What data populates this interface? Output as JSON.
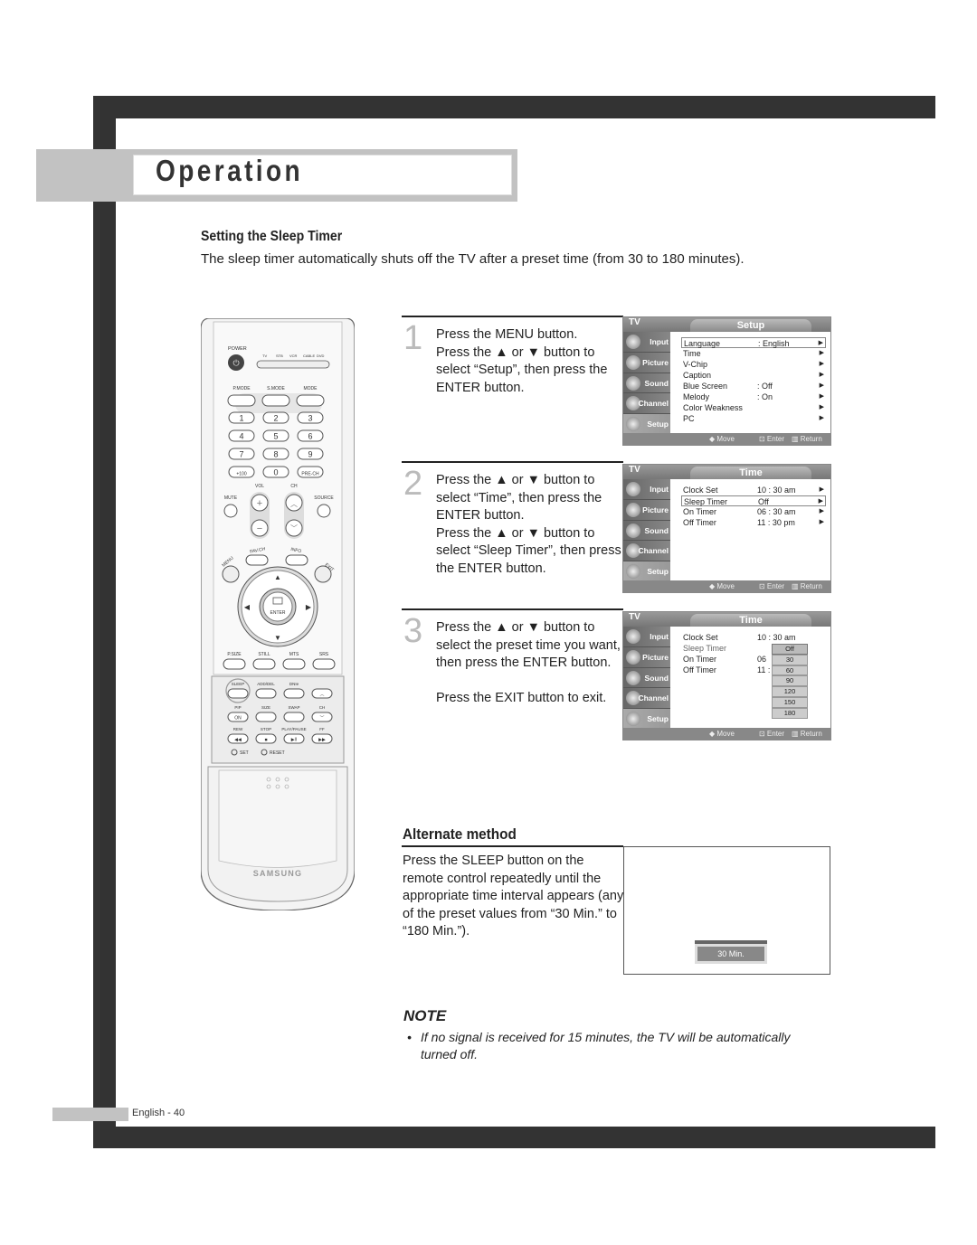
{
  "section_title": "Operation",
  "heading": "Setting the Sleep Timer",
  "intro": "The sleep timer automatically shuts off the TV after a preset time (from 30 to 180 minutes).",
  "remote": {
    "brand": "SAMSUNG",
    "labels": {
      "power": "POWER",
      "sources": [
        "TV",
        "STB",
        "VCR",
        "CABLE",
        "DVD"
      ],
      "modes": [
        "P.MODE",
        "S.MODE",
        "MODE"
      ],
      "digits": [
        "1",
        "2",
        "3",
        "4",
        "5",
        "6",
        "7",
        "8",
        "9",
        "+100",
        "0",
        "PRE-CH"
      ],
      "vol": "VOL",
      "ch": "CH",
      "mute": "MUTE",
      "source": "SOURCE",
      "fav_ch": "FAV.CH",
      "info": "INFO",
      "menu": "MENU",
      "exit": "EXIT",
      "enter": "ENTER",
      "row_fn": [
        "P.SIZE",
        "STILL",
        "MTS",
        "SRS"
      ],
      "row_a": [
        "SLEEP",
        "ADD/DEL",
        "DNIe",
        ""
      ],
      "row_b": [
        "PIP",
        "SIZE",
        "SWAP",
        "CH"
      ],
      "pip_on": "ON",
      "row_c": [
        "REW",
        "STOP",
        "PLAY/PAUSE",
        "FF"
      ],
      "set": "SET",
      "reset": "RESET"
    }
  },
  "steps": [
    {
      "num": "1",
      "lines": [
        "Press the MENU button.",
        "Press the ▲ or ▼ button to select “Setup”, then press the ENTER button."
      ]
    },
    {
      "num": "2",
      "lines": [
        "Press the ▲ or ▼ button to select “Time”, then press the ENTER button.",
        "Press the ▲ or ▼ button to select “Sleep Timer”, then press the ENTER button."
      ]
    },
    {
      "num": "3",
      "lines": [
        "Press the ▲ or ▼ button to select the preset time you want, then press the ENTER button.",
        "",
        "Press the EXIT button to exit."
      ]
    }
  ],
  "osd": {
    "tv_label": "TV",
    "sidebar": [
      "Input",
      "Picture",
      "Sound",
      "Channel",
      "Setup"
    ],
    "footer": {
      "move": "◆ Move",
      "enter": "Enter",
      "return": "Return"
    },
    "screens": [
      {
        "title": "Setup",
        "rows": [
          {
            "label": "Language",
            "value": ": English",
            "selected": true
          },
          {
            "label": "Time",
            "value": ""
          },
          {
            "label": "V-Chip",
            "value": ""
          },
          {
            "label": "Caption",
            "value": ""
          },
          {
            "label": "Blue Screen",
            "value": ": Off"
          },
          {
            "label": "Melody",
            "value": ": On"
          },
          {
            "label": "Color Weakness",
            "value": ""
          },
          {
            "label": "PC",
            "value": ""
          }
        ]
      },
      {
        "title": "Time",
        "rows": [
          {
            "label": "Clock Set",
            "value": "10 : 30   am"
          },
          {
            "label": "Sleep Timer",
            "value": "Off",
            "selected": true
          },
          {
            "label": "On Timer",
            "value": "06 : 30   am"
          },
          {
            "label": "Off Timer",
            "value": "11 : 30   pm"
          }
        ]
      },
      {
        "title": "Time",
        "rows": [
          {
            "label": "Clock Set",
            "value": "10 : 30   am"
          },
          {
            "label": "Sleep Timer",
            "value": ""
          },
          {
            "label": "On Timer",
            "value": "06"
          },
          {
            "label": "Off Timer",
            "value": "11 :"
          }
        ],
        "dropdown": [
          "Off",
          "30",
          "60",
          "90",
          "120",
          "150",
          "180"
        ],
        "dropdown_selected": "Off"
      }
    ]
  },
  "alternate": {
    "heading": "Alternate method",
    "text": "Press the SLEEP button on the remote control repeatedly until the appropriate time interval appears (any of the preset values from “30 Min.” to “180 Min.”).",
    "display": "30 Min."
  },
  "note": {
    "heading": "NOTE",
    "bullet": "•",
    "text": "If no signal is received for 15 minutes, the TV will be automatically turned off."
  },
  "footer": {
    "page_label": "English - 40"
  }
}
